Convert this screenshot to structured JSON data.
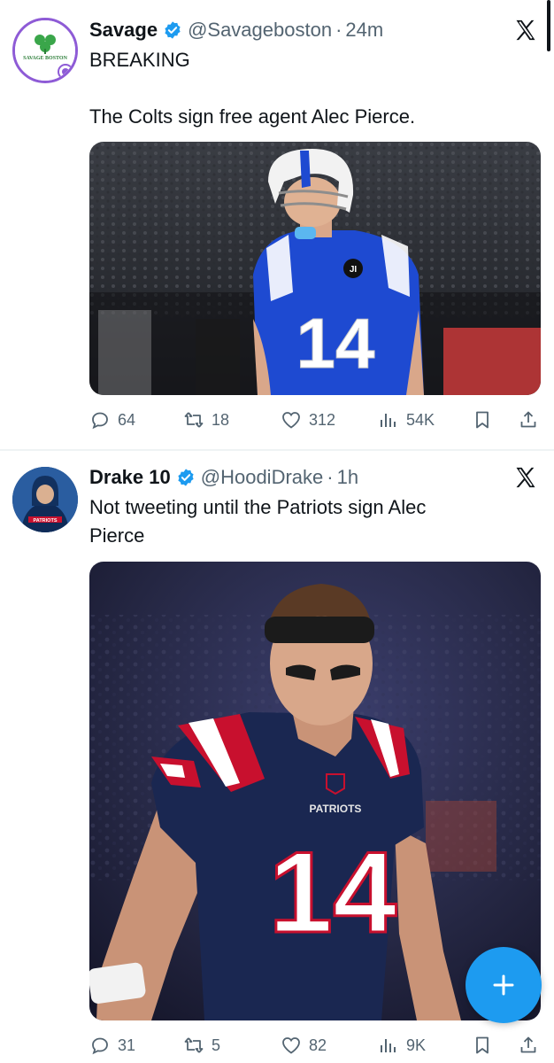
{
  "tweets": [
    {
      "author": {
        "name": "Savage",
        "handle": "@Savageboston",
        "avatar_text": "SAVAGE BOSTON"
      },
      "time": "24m",
      "text": "BREAKING\n\nThe Colts sign free agent Alec Pierce.",
      "media": {
        "jersey_number": "14",
        "patch_text": "JI"
      },
      "stats": {
        "replies": "64",
        "retweets": "18",
        "likes": "312",
        "views": "54K"
      }
    },
    {
      "author": {
        "name": "Drake 10",
        "handle": "@HoodiDrake",
        "avatar_text": "PATRIOTS"
      },
      "time": "1h",
      "text": "Not tweeting until the Patriots sign Alec\nPierce",
      "media": {
        "jersey_number": "14",
        "chest_text": "PATRIOTS"
      },
      "stats": {
        "replies": "31",
        "retweets": "5",
        "likes": "82",
        "views": "9K"
      }
    }
  ],
  "separator": "·",
  "icons": {
    "verified": "verified-badge-icon",
    "platform": "x-logo-icon",
    "reply": "reply-icon",
    "retweet": "retweet-icon",
    "like": "heart-icon",
    "views": "views-chart-icon",
    "bookmark": "bookmark-icon",
    "share": "share-icon",
    "compose": "plus-icon"
  },
  "colors": {
    "accent": "#1d9bf0",
    "text": "#0f1419",
    "muted": "#536471",
    "verified": "#1d9bf0"
  }
}
